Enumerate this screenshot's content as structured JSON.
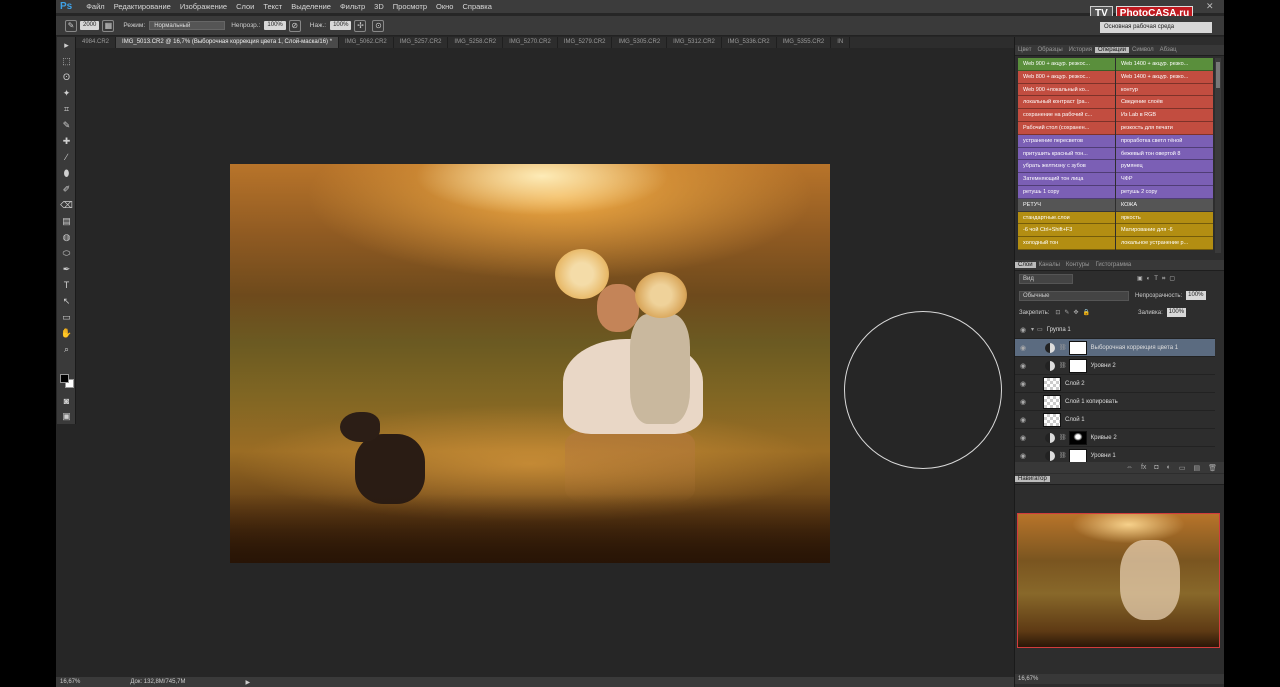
{
  "app": {
    "logo": "Ps"
  },
  "menu": [
    "Файл",
    "Редактирование",
    "Изображение",
    "Слои",
    "Текст",
    "Выделение",
    "Фильтр",
    "3D",
    "Просмотр",
    "Окно",
    "Справка"
  ],
  "window_controls": {
    "minimize": "—",
    "close": "✕"
  },
  "brand": {
    "tv": "TV",
    "name": "PhotoCASA.ru"
  },
  "options": {
    "brush_size": "2000",
    "mode_label": "Режим:",
    "mode_value": "Нормальный",
    "opacity_label": "Непрозр.:",
    "opacity_value": "100%",
    "flow_label": "Наж.:",
    "flow_value": "100%"
  },
  "workspace": "Основная рабочая среда",
  "tabs": [
    "4984.CR2",
    "IMG_5013.CR2 @ 16,7% (Выборочная коррекция цвета 1, Слой-маска/16) *",
    "IMG_5062.CR2",
    "IMG_5257.CR2",
    "IMG_5258.CR2",
    "IMG_5270.CR2",
    "IMG_5279.CR2",
    "IMG_5305.CR2",
    "IMG_5312.CR2",
    "IMG_5336.CR2",
    "IMG_5355.CR2",
    "IN"
  ],
  "tools": [
    "▸",
    "⬚",
    "ʘ",
    "✦",
    "⌗",
    "✎",
    "✚",
    "∕",
    "⬮",
    "✐",
    "⌫",
    "▤",
    "◍",
    "⬭",
    "✒",
    "T",
    "↖",
    "▭",
    "✋",
    "⌕"
  ],
  "status": {
    "zoom": "16,67%",
    "doc": "Док: 132,8M/745,7M"
  },
  "panel_tabs_top": [
    "Цвет",
    "Образцы",
    "История",
    "Операции",
    "Символ",
    "Абзац"
  ],
  "actions": [
    [
      {
        "label": "Web 900 + акцур. резкос...",
        "color": "green"
      },
      {
        "label": "Web 1400 + акцур. резко...",
        "color": "green"
      }
    ],
    [
      {
        "label": "Web 800 + акцур. резкос...",
        "color": "red"
      },
      {
        "label": "Web 1400 + акцур. резко...",
        "color": "red"
      }
    ],
    [
      {
        "label": "Web 900 +локальный ко...",
        "color": "red"
      },
      {
        "label": "контур",
        "color": "red"
      }
    ],
    [
      {
        "label": "локальный контраст (ра...",
        "color": "red"
      },
      {
        "label": "Сведение слоёв",
        "color": "red"
      }
    ],
    [
      {
        "label": "сохранение на рабочий с...",
        "color": "red"
      },
      {
        "label": "Из Lab в RGB",
        "color": "red"
      }
    ],
    [
      {
        "label": "Рабочий стол (сохранен...",
        "color": "red"
      },
      {
        "label": "резкость для печати",
        "color": "red"
      }
    ],
    [
      {
        "label": "устранение пересветов",
        "color": "purple"
      },
      {
        "label": "проработка светл тёной",
        "color": "purple"
      }
    ],
    [
      {
        "label": "притушить красный тон...",
        "color": "purple"
      },
      {
        "label": "бежевый тон овертой 8",
        "color": "purple"
      }
    ],
    [
      {
        "label": "убрать желтизну с зубов",
        "color": "purple"
      },
      {
        "label": "румянец",
        "color": "purple"
      }
    ],
    [
      {
        "label": "Затемняющий тон лица",
        "color": "purple"
      },
      {
        "label": "ЧФР",
        "color": "purple"
      }
    ],
    [
      {
        "label": "ретушь 1 copy",
        "color": "purple"
      },
      {
        "label": "ретушь 2 copy",
        "color": "purple"
      }
    ],
    [
      {
        "label": "РЕТУЧ",
        "color": "gray"
      },
      {
        "label": "КОЖА",
        "color": "gray"
      }
    ],
    [
      {
        "label": "стандартные.слои",
        "color": "gold"
      },
      {
        "label": "яркость",
        "color": "gold"
      }
    ],
    [
      {
        "label": "-6 чой          Ctrl+Shift+F3",
        "color": "gold"
      },
      {
        "label": "Матирование для -6",
        "color": "gold"
      }
    ],
    [
      {
        "label": "холодный тон",
        "color": "gold"
      },
      {
        "label": "локальное устранение р...",
        "color": "gold"
      }
    ]
  ],
  "colors": {
    "green": "#5a8f3c",
    "red": "#c24d40",
    "purple": "#7b5fb5",
    "gray": "#555555",
    "gold": "#b38e12"
  },
  "layers_panel": {
    "tabs": [
      "Слои",
      "Каналы",
      "Контуры",
      "Гистограмма"
    ],
    "filter": "Вид",
    "blend_mode": "Обычные",
    "opacity_label": "Непрозрачность:",
    "opacity_value": "100%",
    "lock_label": "Закрепить:",
    "fill_label": "Заливка:",
    "fill_value": "100%",
    "layers": [
      {
        "name": "Группа 1",
        "type": "group",
        "selected": false
      },
      {
        "name": "Выборочная коррекция цвета 1",
        "type": "adjustment",
        "selected": true
      },
      {
        "name": "Уровни 2",
        "type": "adjustment",
        "selected": false
      },
      {
        "name": "Слой 2",
        "type": "pixel",
        "selected": false
      },
      {
        "name": "Слой 1 копировать",
        "type": "pixel",
        "selected": false
      },
      {
        "name": "Слой 1",
        "type": "pixel",
        "selected": false
      },
      {
        "name": "Кривые 2",
        "type": "adjustment-mask",
        "selected": false
      },
      {
        "name": "Уровни 1",
        "type": "adjustment",
        "selected": false
      }
    ],
    "bottom_icons": [
      "⇔",
      "fx",
      "◘",
      "◐",
      "▭",
      "▤",
      "🗑"
    ]
  },
  "navigator": {
    "title": "Навигатор",
    "zoom": "16,67%"
  }
}
